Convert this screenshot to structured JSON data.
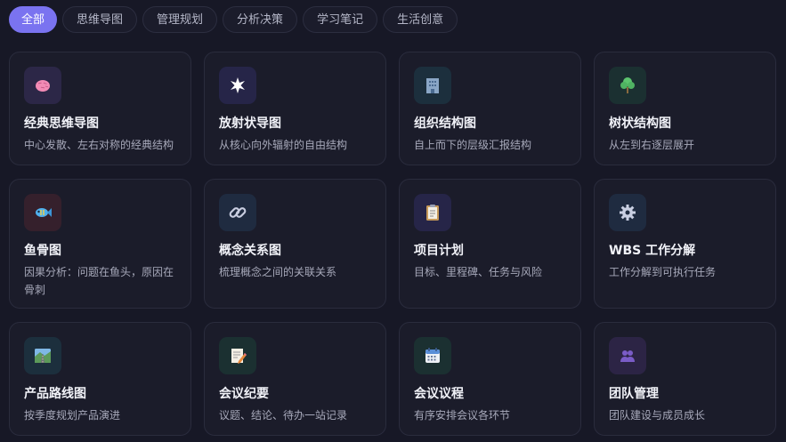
{
  "tabs": [
    {
      "label": "全部",
      "active": true
    },
    {
      "label": "思维导图",
      "active": false
    },
    {
      "label": "管理规划",
      "active": false
    },
    {
      "label": "分析决策",
      "active": false
    },
    {
      "label": "学习笔记",
      "active": false
    },
    {
      "label": "生活创意",
      "active": false
    }
  ],
  "cards": [
    {
      "title": "经典思维导图",
      "desc": "中心发散、左右对称的经典结构",
      "icon": "brain-icon"
    },
    {
      "title": "放射状导图",
      "desc": "从核心向外辐射的自由结构",
      "icon": "starburst-icon"
    },
    {
      "title": "组织结构图",
      "desc": "自上而下的层级汇报结构",
      "icon": "building-icon"
    },
    {
      "title": "树状结构图",
      "desc": "从左到右逐层展开",
      "icon": "tree-icon"
    },
    {
      "title": "鱼骨图",
      "desc": "因果分析：问题在鱼头，原因在骨刺",
      "icon": "fish-icon"
    },
    {
      "title": "概念关系图",
      "desc": "梳理概念之间的关联关系",
      "icon": "link-icon"
    },
    {
      "title": "项目计划",
      "desc": "目标、里程碑、任务与风险",
      "icon": "clipboard-icon"
    },
    {
      "title": "WBS 工作分解",
      "desc": "工作分解到可执行任务",
      "icon": "gear-icon"
    },
    {
      "title": "产品路线图",
      "desc": "按季度规划产品演进",
      "icon": "road-icon"
    },
    {
      "title": "会议纪要",
      "desc": "议题、结论、待办一站记录",
      "icon": "memo-icon"
    },
    {
      "title": "会议议程",
      "desc": "有序安排会议各环节",
      "icon": "calendar-icon"
    },
    {
      "title": "团队管理",
      "desc": "团队建设与成员成长",
      "icon": "team-icon"
    }
  ],
  "colors": {
    "accent": "#7a73f0",
    "background": "#171826",
    "card": "#1b1c2a"
  }
}
